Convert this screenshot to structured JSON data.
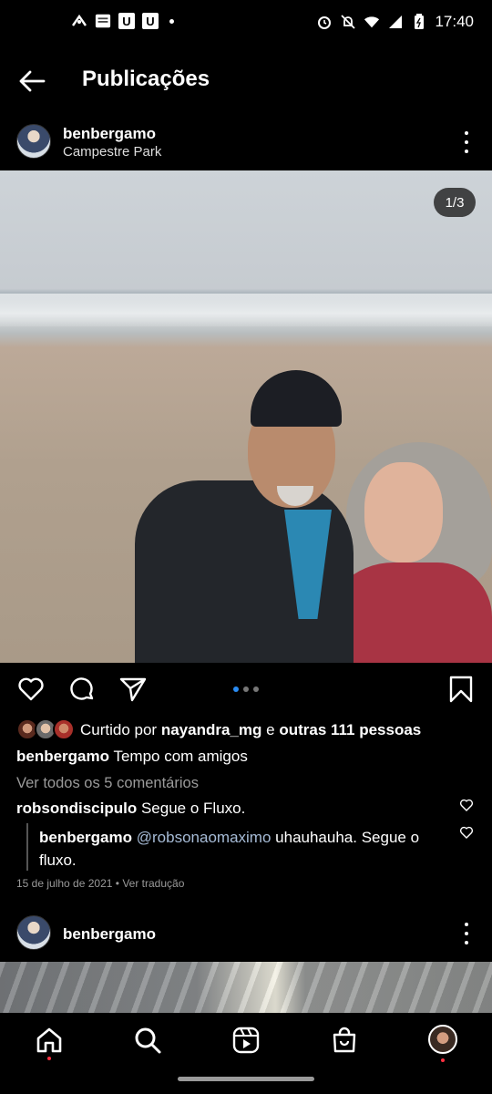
{
  "status_bar": {
    "time": "17:40",
    "left_icons": [
      "signal-tower-icon",
      "bible-app-icon",
      "u-app-icon",
      "u-app-icon",
      "dot-icon"
    ],
    "right_icons": [
      "alarm-icon",
      "mute-icon",
      "wifi-icon",
      "signal-icon",
      "battery-icon"
    ]
  },
  "header": {
    "title": "Publicações",
    "back_icon": "arrow-left-icon"
  },
  "post": {
    "username": "benbergamo",
    "location": "Campestre Park",
    "image_counter": "1/3",
    "carousel": {
      "total": 3,
      "active": 1
    },
    "liked_by": {
      "prefix": "Curtido por",
      "user": "nayandra_mg",
      "joiner": "e",
      "others": "outras 111 pessoas"
    },
    "caption": {
      "username": "benbergamo",
      "text": "Tempo com amigos"
    },
    "view_all_comments": "Ver todos os 5 comentários",
    "comments": [
      {
        "username": "robsondiscipulo",
        "text": "Segue o Fluxo."
      }
    ],
    "reply": {
      "username": "benbergamo",
      "mention": "@robsonaomaximo",
      "text": "uhauhauha. Segue o fluxo."
    },
    "date": "15 de julho de 2021",
    "translate": "Ver tradução"
  },
  "post2": {
    "username": "benbergamo"
  },
  "nav": {
    "items": [
      "home-icon",
      "search-icon",
      "reels-icon",
      "shop-icon",
      "profile-avatar"
    ]
  },
  "colors": {
    "background": "#000000",
    "accent_blue": "#2a8cf3",
    "mention": "#a6bbd6",
    "notification_dot": "#ff3040"
  }
}
